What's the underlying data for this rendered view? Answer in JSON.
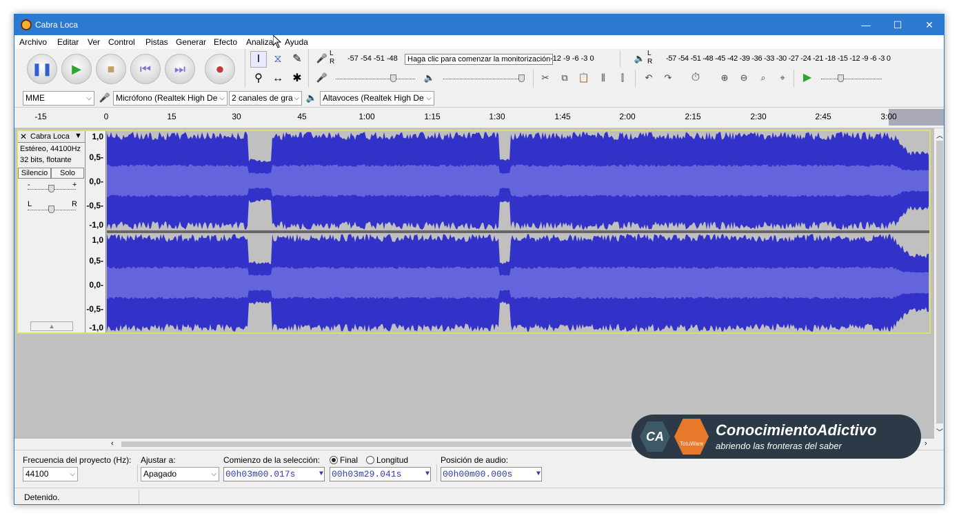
{
  "window": {
    "title": "Cabra Loca",
    "minimize": "—",
    "maximize": "☐",
    "close": "✕"
  },
  "menu": [
    "Archivo",
    "Editar",
    "Ver",
    "Control",
    "Pistas",
    "Generar",
    "Efecto",
    "Analizar",
    "Ayuda"
  ],
  "transport": {
    "pause": "❚❚",
    "play": "▶",
    "stop": "■",
    "skip_start": "⏮",
    "skip_end": "⏭",
    "record": "●"
  },
  "meters": {
    "record_scale": "-57 -54 -51 -48",
    "record_hint": "Haga clic para comenzar la monitorización",
    "record_scale_tail": "-12 -9 -6 -3 0",
    "play_scale": "-57 -54 -51 -48 -45 -42 -39 -36 -33 -30 -27 -24 -21 -18 -15 -12 -9 -6 -3 0",
    "L": "L",
    "R": "R"
  },
  "device": {
    "host": "MME",
    "mic": "Micrófono (Realtek High De",
    "channels": "2 canales de gra",
    "speakers": "Altavoces (Realtek High De"
  },
  "ruler": [
    "-15",
    "0",
    "15",
    "30",
    "45",
    "1:00",
    "1:15",
    "1:30",
    "1:45",
    "2:00",
    "2:15",
    "2:30",
    "2:45",
    "3:00"
  ],
  "track": {
    "name": "Cabra Loca",
    "format": "Estéreo, 44100Hz",
    "bits": "32 bits, flotante",
    "mute": "Silencio",
    "solo": "Solo",
    "gain_minus": "-",
    "gain_plus": "+",
    "pan_left": "L",
    "pan_right": "R",
    "collapse": "▲",
    "scale": [
      "1,0",
      "0,5-",
      "0,0-",
      "-0,5-",
      "-1,0"
    ]
  },
  "colors": {
    "wave_peak": "#3232c8",
    "wave_rms": "#6464dc",
    "track_bg": "#c0c0c0",
    "titlebar": "#2b79d0",
    "selection_border": "#dede70"
  },
  "selection_bar": {
    "rate_label": "Frecuencia del proyecto (Hz):",
    "rate_value": "44100",
    "snap_label": "Ajustar a:",
    "snap_value": "Apagado",
    "sel_label": "Comienzo de la selección:",
    "end_label": "Final",
    "length_label": "Longitud",
    "start_time": "00h03m00.017s",
    "end_time": "00h03m29.041s",
    "pos_label": "Posición de audio:",
    "pos_time": "00h00m00.000s"
  },
  "status": "Detenido.",
  "watermark": {
    "badge1": "CA",
    "badge2": "TotuWare",
    "title": "ConocimientoAdictivo",
    "subtitle": "abriendo las fronteras del saber"
  }
}
